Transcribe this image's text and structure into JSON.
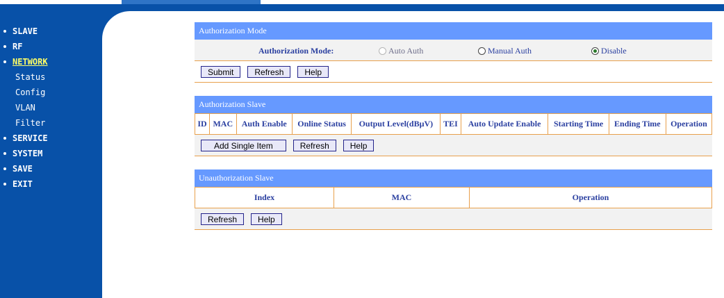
{
  "sidebar": {
    "items": [
      {
        "label": "SLAVE"
      },
      {
        "label": "RF"
      },
      {
        "label": "NETWORK",
        "active": true
      },
      {
        "label": "Status"
      },
      {
        "label": "Config"
      },
      {
        "label": "VLAN"
      },
      {
        "label": "Filter"
      },
      {
        "label": "SERVICE"
      },
      {
        "label": "SYSTEM"
      },
      {
        "label": "SAVE"
      },
      {
        "label": "EXIT"
      }
    ]
  },
  "auth_mode": {
    "title": "Authorization Mode",
    "label": "Authorization Mode:",
    "options": [
      {
        "label": "Auto Auth",
        "checked": false,
        "disabled": true
      },
      {
        "label": "Manual Auth",
        "checked": false,
        "disabled": false
      },
      {
        "label": "Disable",
        "checked": true,
        "disabled": false
      }
    ],
    "buttons": {
      "submit": "Submit",
      "refresh": "Refresh",
      "help": "Help"
    }
  },
  "auth_slave": {
    "title": "Authorization Slave",
    "columns": [
      "ID",
      "MAC",
      "Auth Enable",
      "Online Status",
      "Output Level(dBµV)",
      "TEI",
      "Auto Update Enable",
      "Starting Time",
      "Ending Time",
      "Operation"
    ],
    "buttons": {
      "add": "Add Single Item",
      "refresh": "Refresh",
      "help": "Help"
    }
  },
  "unauth_slave": {
    "title": "Unauthorization Slave",
    "columns": [
      "Index",
      "MAC",
      "Operation"
    ],
    "buttons": {
      "refresh": "Refresh",
      "help": "Help"
    }
  },
  "colors": {
    "sidebar": "#0851a8",
    "panel_header": "#6699ff",
    "border": "#e8a04c",
    "text": "#2a3fa0"
  }
}
